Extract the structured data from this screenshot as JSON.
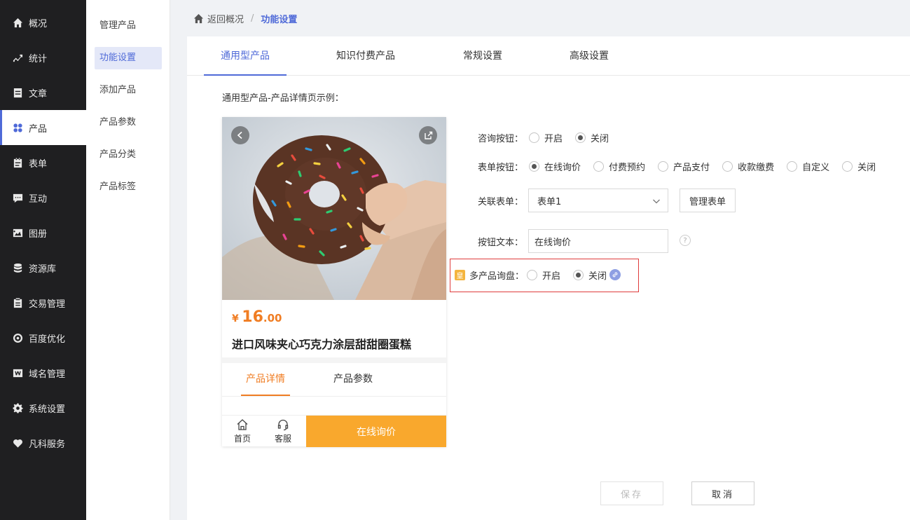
{
  "sidebar": {
    "items": [
      {
        "label": "概况",
        "icon": "home-icon"
      },
      {
        "label": "统计",
        "icon": "stats-icon"
      },
      {
        "label": "文章",
        "icon": "article-icon"
      },
      {
        "label": "产品",
        "icon": "product-icon",
        "active": true
      },
      {
        "label": "表单",
        "icon": "form-icon"
      },
      {
        "label": "互动",
        "icon": "chat-icon"
      },
      {
        "label": "图册",
        "icon": "album-icon"
      },
      {
        "label": "资源库",
        "icon": "database-icon"
      },
      {
        "label": "交易管理",
        "icon": "order-icon"
      },
      {
        "label": "百度优化",
        "icon": "seo-icon"
      },
      {
        "label": "域名管理",
        "icon": "domain-icon"
      },
      {
        "label": "系统设置",
        "icon": "gear-icon"
      },
      {
        "label": "凡科服务",
        "icon": "heart-icon"
      }
    ]
  },
  "submenu": {
    "items": [
      {
        "label": "管理产品"
      },
      {
        "label": "功能设置",
        "active": true
      },
      {
        "label": "添加产品"
      },
      {
        "label": "产品参数"
      },
      {
        "label": "产品分类"
      },
      {
        "label": "产品标签"
      }
    ]
  },
  "breadcrumb": {
    "back": "返回概况",
    "sep": "/",
    "current": "功能设置"
  },
  "tabs": [
    {
      "label": "通用型产品",
      "active": true
    },
    {
      "label": "知识付费产品"
    },
    {
      "label": "常规设置"
    },
    {
      "label": "高级设置"
    }
  ],
  "example_title": "通用型产品-产品详情页示例：",
  "preview": {
    "currency": "¥",
    "price_int": "16",
    "price_dec": ".00",
    "product_name": "进口风味夹心巧克力涂层甜甜圈蛋糕",
    "detail_tabs": [
      {
        "label": "产品详情",
        "active": true
      },
      {
        "label": "产品参数"
      }
    ],
    "home_label": "首页",
    "service_label": "客服",
    "inquire_label": "在线询价"
  },
  "form": {
    "consult": {
      "label": "咨询按钮：",
      "options": [
        "开启",
        "关闭"
      ],
      "selected": "关闭"
    },
    "form_button": {
      "label": "表单按钮：",
      "options": [
        "在线询价",
        "付费预约",
        "产品支付",
        "收款缴费",
        "自定义",
        "关闭"
      ],
      "selected": "在线询价"
    },
    "linked_form": {
      "label": "关联表单：",
      "value": "表单1",
      "manage_label": "管理表单"
    },
    "button_text": {
      "label": "按钮文本：",
      "value": "在线询价",
      "help": "?"
    },
    "multi_inquiry": {
      "badge": "皇",
      "label": "多产品询盘：",
      "options": [
        "开启",
        "关闭"
      ],
      "selected": "关闭"
    }
  },
  "actions": {
    "save": "保存",
    "cancel": "取消"
  },
  "colors": {
    "accent": "#4f6ad8",
    "orange": "#f07d23",
    "inquire_bg": "#f9a82d",
    "sidebar_bg": "#1f1f21",
    "highlight_border": "#e03c3c"
  }
}
